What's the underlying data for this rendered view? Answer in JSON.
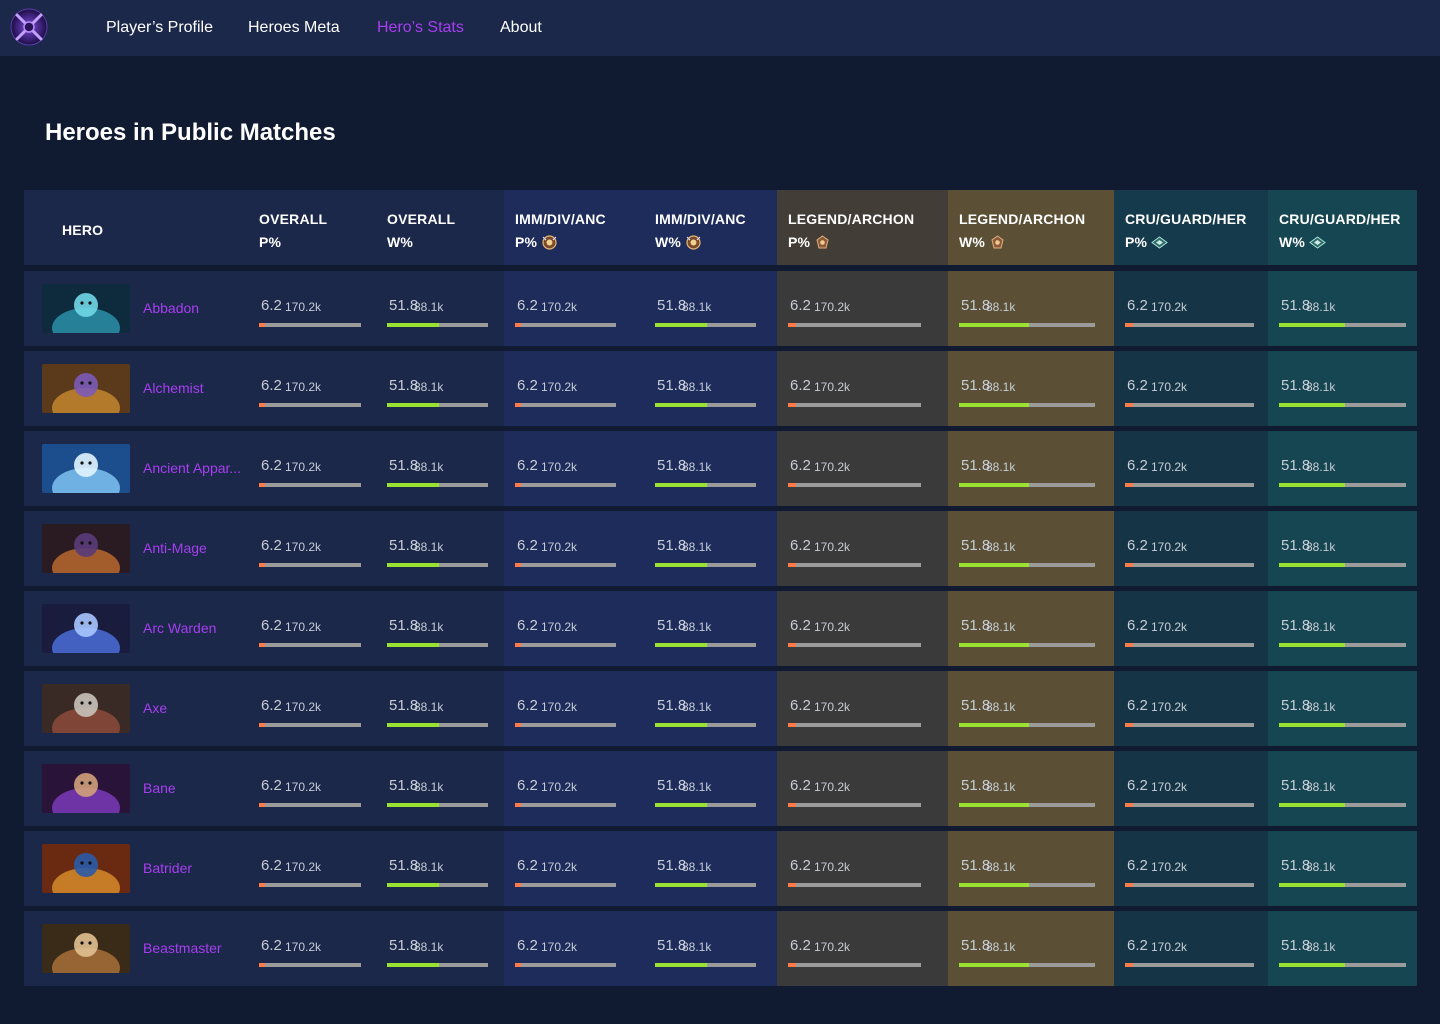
{
  "nav": {
    "logo_icon": "dota-logo-icon",
    "items": [
      {
        "label": "Player’s Profile",
        "active": false
      },
      {
        "label": "Heroes Meta",
        "active": false
      },
      {
        "label": "Hero’s Stats",
        "active": true
      },
      {
        "label": "About",
        "active": false
      }
    ],
    "active_color": "#a73ef0"
  },
  "page_title": "Heroes in Public Matches",
  "table": {
    "headers": [
      {
        "line1": "HERO",
        "line2": "",
        "icon": ""
      },
      {
        "line1": "OVERALL",
        "line2": "P%",
        "icon": ""
      },
      {
        "line1": "OVERALL",
        "line2": "W%",
        "icon": ""
      },
      {
        "line1": "IMM/DIV/ANC",
        "line2": "P%",
        "icon": "divine-rank-icon"
      },
      {
        "line1": "IMM/DIV/ANC",
        "line2": "W%",
        "icon": "divine-rank-icon"
      },
      {
        "line1": "LEGEND/ARCHON",
        "line2": "P%",
        "icon": "legend-rank-icon"
      },
      {
        "line1": "LEGEND/ARCHON",
        "line2": "W%",
        "icon": "legend-rank-icon"
      },
      {
        "line1": "CRU/GUARD/HER",
        "line2": "P%",
        "icon": "crusader-rank-icon"
      },
      {
        "line1": "CRU/GUARD/HER",
        "line2": "W%",
        "icon": "crusader-rank-icon"
      }
    ],
    "group_colors": {
      "overall": "#1b284a",
      "imm_div_anc": "#1d2c5a",
      "legend_archon_p": "#3a3a3a",
      "legend_archon_w": "#5b5036",
      "cru_guard_her_p": "#153546",
      "cru_guard_her_w": "#154652"
    },
    "pick_bar_color": "#ff7a4a",
    "win_bar_color": "#9ae232",
    "rows": [
      {
        "hero": "Abbadon",
        "portrait": "abbadon-portrait",
        "stats": [
          {
            "value": "6.2",
            "count": "170.2k",
            "fraction": 0.062
          },
          {
            "value": "51.8",
            "count": "88.1k",
            "fraction": 0.518
          },
          {
            "value": "6.2",
            "count": "170.2k",
            "fraction": 0.062
          },
          {
            "value": "51.8",
            "count": "88.1k",
            "fraction": 0.518
          },
          {
            "value": "6.2",
            "count": "170.2k",
            "fraction": 0.062
          },
          {
            "value": "51.8",
            "count": "88.1k",
            "fraction": 0.518
          },
          {
            "value": "6.2",
            "count": "170.2k",
            "fraction": 0.062
          },
          {
            "value": "51.8",
            "count": "88.1k",
            "fraction": 0.518
          }
        ]
      },
      {
        "hero": "Alchemist",
        "portrait": "alchemist-portrait",
        "stats": [
          {
            "value": "6.2",
            "count": "170.2k",
            "fraction": 0.062
          },
          {
            "value": "51.8",
            "count": "88.1k",
            "fraction": 0.518
          },
          {
            "value": "6.2",
            "count": "170.2k",
            "fraction": 0.062
          },
          {
            "value": "51.8",
            "count": "88.1k",
            "fraction": 0.518
          },
          {
            "value": "6.2",
            "count": "170.2k",
            "fraction": 0.062
          },
          {
            "value": "51.8",
            "count": "88.1k",
            "fraction": 0.518
          },
          {
            "value": "6.2",
            "count": "170.2k",
            "fraction": 0.062
          },
          {
            "value": "51.8",
            "count": "88.1k",
            "fraction": 0.518
          }
        ]
      },
      {
        "hero": "Ancient Appar...",
        "portrait": "ancient-apparition-portrait",
        "stats": [
          {
            "value": "6.2",
            "count": "170.2k",
            "fraction": 0.062
          },
          {
            "value": "51.8",
            "count": "88.1k",
            "fraction": 0.518
          },
          {
            "value": "6.2",
            "count": "170.2k",
            "fraction": 0.062
          },
          {
            "value": "51.8",
            "count": "88.1k",
            "fraction": 0.518
          },
          {
            "value": "6.2",
            "count": "170.2k",
            "fraction": 0.062
          },
          {
            "value": "51.8",
            "count": "88.1k",
            "fraction": 0.518
          },
          {
            "value": "6.2",
            "count": "170.2k",
            "fraction": 0.062
          },
          {
            "value": "51.8",
            "count": "88.1k",
            "fraction": 0.518
          }
        ]
      },
      {
        "hero": "Anti-Mage",
        "portrait": "anti-mage-portrait",
        "stats": [
          {
            "value": "6.2",
            "count": "170.2k",
            "fraction": 0.062
          },
          {
            "value": "51.8",
            "count": "88.1k",
            "fraction": 0.518
          },
          {
            "value": "6.2",
            "count": "170.2k",
            "fraction": 0.062
          },
          {
            "value": "51.8",
            "count": "88.1k",
            "fraction": 0.518
          },
          {
            "value": "6.2",
            "count": "170.2k",
            "fraction": 0.062
          },
          {
            "value": "51.8",
            "count": "88.1k",
            "fraction": 0.518
          },
          {
            "value": "6.2",
            "count": "170.2k",
            "fraction": 0.062
          },
          {
            "value": "51.8",
            "count": "88.1k",
            "fraction": 0.518
          }
        ]
      },
      {
        "hero": "Arc Warden",
        "portrait": "arc-warden-portrait",
        "stats": [
          {
            "value": "6.2",
            "count": "170.2k",
            "fraction": 0.062
          },
          {
            "value": "51.8",
            "count": "88.1k",
            "fraction": 0.518
          },
          {
            "value": "6.2",
            "count": "170.2k",
            "fraction": 0.062
          },
          {
            "value": "51.8",
            "count": "88.1k",
            "fraction": 0.518
          },
          {
            "value": "6.2",
            "count": "170.2k",
            "fraction": 0.062
          },
          {
            "value": "51.8",
            "count": "88.1k",
            "fraction": 0.518
          },
          {
            "value": "6.2",
            "count": "170.2k",
            "fraction": 0.062
          },
          {
            "value": "51.8",
            "count": "88.1k",
            "fraction": 0.518
          }
        ]
      },
      {
        "hero": "Axe",
        "portrait": "axe-portrait",
        "stats": [
          {
            "value": "6.2",
            "count": "170.2k",
            "fraction": 0.062
          },
          {
            "value": "51.8",
            "count": "88.1k",
            "fraction": 0.518
          },
          {
            "value": "6.2",
            "count": "170.2k",
            "fraction": 0.062
          },
          {
            "value": "51.8",
            "count": "88.1k",
            "fraction": 0.518
          },
          {
            "value": "6.2",
            "count": "170.2k",
            "fraction": 0.062
          },
          {
            "value": "51.8",
            "count": "88.1k",
            "fraction": 0.518
          },
          {
            "value": "6.2",
            "count": "170.2k",
            "fraction": 0.062
          },
          {
            "value": "51.8",
            "count": "88.1k",
            "fraction": 0.518
          }
        ]
      },
      {
        "hero": "Bane",
        "portrait": "bane-portrait",
        "stats": [
          {
            "value": "6.2",
            "count": "170.2k",
            "fraction": 0.062
          },
          {
            "value": "51.8",
            "count": "88.1k",
            "fraction": 0.518
          },
          {
            "value": "6.2",
            "count": "170.2k",
            "fraction": 0.062
          },
          {
            "value": "51.8",
            "count": "88.1k",
            "fraction": 0.518
          },
          {
            "value": "6.2",
            "count": "170.2k",
            "fraction": 0.062
          },
          {
            "value": "51.8",
            "count": "88.1k",
            "fraction": 0.518
          },
          {
            "value": "6.2",
            "count": "170.2k",
            "fraction": 0.062
          },
          {
            "value": "51.8",
            "count": "88.1k",
            "fraction": 0.518
          }
        ]
      },
      {
        "hero": "Batrider",
        "portrait": "batrider-portrait",
        "stats": [
          {
            "value": "6.2",
            "count": "170.2k",
            "fraction": 0.062
          },
          {
            "value": "51.8",
            "count": "88.1k",
            "fraction": 0.518
          },
          {
            "value": "6.2",
            "count": "170.2k",
            "fraction": 0.062
          },
          {
            "value": "51.8",
            "count": "88.1k",
            "fraction": 0.518
          },
          {
            "value": "6.2",
            "count": "170.2k",
            "fraction": 0.062
          },
          {
            "value": "51.8",
            "count": "88.1k",
            "fraction": 0.518
          },
          {
            "value": "6.2",
            "count": "170.2k",
            "fraction": 0.062
          },
          {
            "value": "51.8",
            "count": "88.1k",
            "fraction": 0.518
          }
        ]
      },
      {
        "hero": "Beastmaster",
        "portrait": "beastmaster-portrait",
        "stats": [
          {
            "value": "6.2",
            "count": "170.2k",
            "fraction": 0.062
          },
          {
            "value": "51.8",
            "count": "88.1k",
            "fraction": 0.518
          },
          {
            "value": "6.2",
            "count": "170.2k",
            "fraction": 0.062
          },
          {
            "value": "51.8",
            "count": "88.1k",
            "fraction": 0.518
          },
          {
            "value": "6.2",
            "count": "170.2k",
            "fraction": 0.062
          },
          {
            "value": "51.8",
            "count": "88.1k",
            "fraction": 0.518
          },
          {
            "value": "6.2",
            "count": "170.2k",
            "fraction": 0.062
          },
          {
            "value": "51.8",
            "count": "88.1k",
            "fraction": 0.518
          }
        ]
      }
    ]
  }
}
